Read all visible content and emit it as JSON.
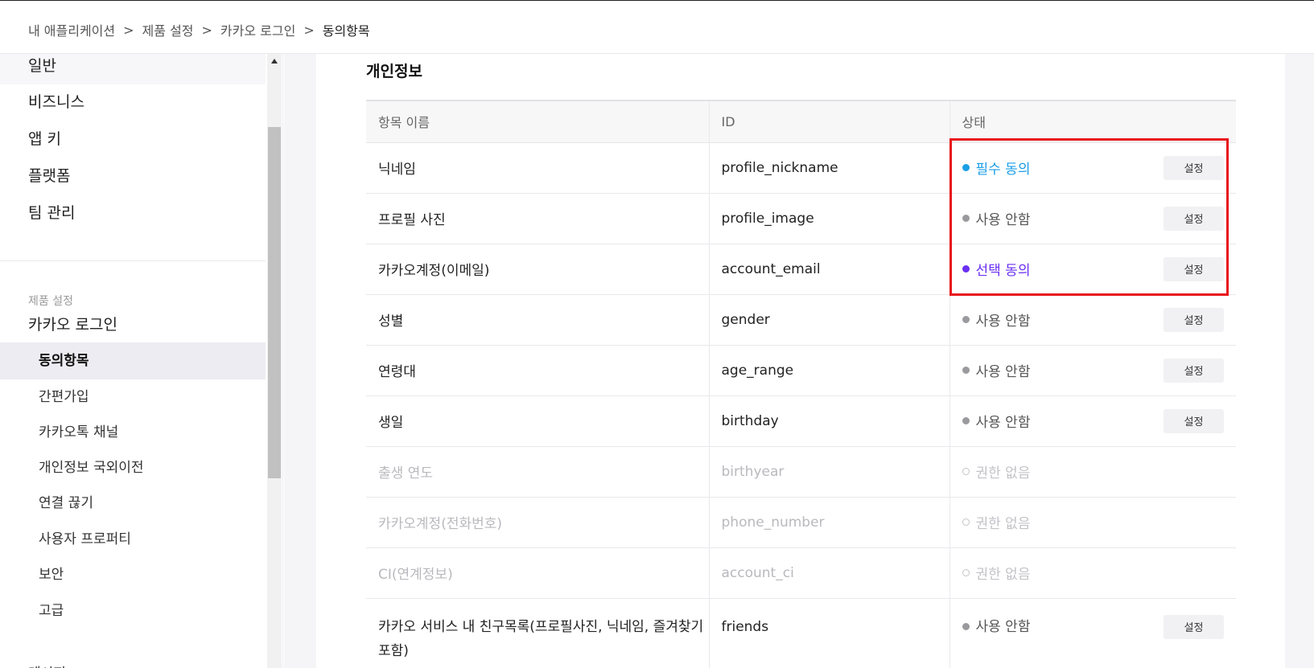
{
  "breadcrumb": {
    "items": [
      "내 애플리케이션",
      "제품 설정",
      "카카오 로그인"
    ],
    "separator": ">",
    "current": "동의항목"
  },
  "sidebar": {
    "main_items": [
      "일반",
      "비즈니스",
      "앱 키",
      "플랫폼",
      "팀 관리"
    ],
    "group_label": "제품 설정",
    "group_title": "카카오 로그인",
    "sub_items": [
      "동의항목",
      "간편가입",
      "카카오톡 채널",
      "개인정보 국외이전",
      "연결 끊기",
      "사용자 프로퍼티",
      "보안",
      "고급"
    ],
    "active_sub": "동의항목",
    "cut_off_item": "메시지"
  },
  "section": {
    "title": "개인정보"
  },
  "table": {
    "headers": {
      "name": "항목 이름",
      "id": "ID",
      "status": "상태"
    },
    "setting_label": "설정",
    "rows": [
      {
        "name": "닉네임",
        "id": "profile_nickname",
        "status": "필수 동의",
        "kind": "required"
      },
      {
        "name": "프로필 사진",
        "id": "profile_image",
        "status": "사용 안함",
        "kind": "unused"
      },
      {
        "name": "카카오계정(이메일)",
        "id": "account_email",
        "status": "선택 동의",
        "kind": "optional"
      },
      {
        "name": "성별",
        "id": "gender",
        "status": "사용 안함",
        "kind": "unused"
      },
      {
        "name": "연령대",
        "id": "age_range",
        "status": "사용 안함",
        "kind": "unused"
      },
      {
        "name": "생일",
        "id": "birthday",
        "status": "사용 안함",
        "kind": "unused"
      },
      {
        "name": "출생 연도",
        "id": "birthyear",
        "status": "권한 없음",
        "kind": "none"
      },
      {
        "name": "카카오계정(전화번호)",
        "id": "phone_number",
        "status": "권한 없음",
        "kind": "none"
      },
      {
        "name": "CI(연계정보)",
        "id": "account_ci",
        "status": "권한 없음",
        "kind": "none"
      },
      {
        "name": "카카오 서비스 내 친구목록(프로필사진, 닉네임, 즐겨찾기 포함)",
        "id": "friends",
        "status": "사용 안함",
        "kind": "unused"
      }
    ]
  },
  "colors": {
    "required": "#1a9ee6",
    "optional": "#6a2ff2",
    "unused": "#9a9a9e",
    "none": "#c3c3c8",
    "highlight": "#e8141c"
  }
}
